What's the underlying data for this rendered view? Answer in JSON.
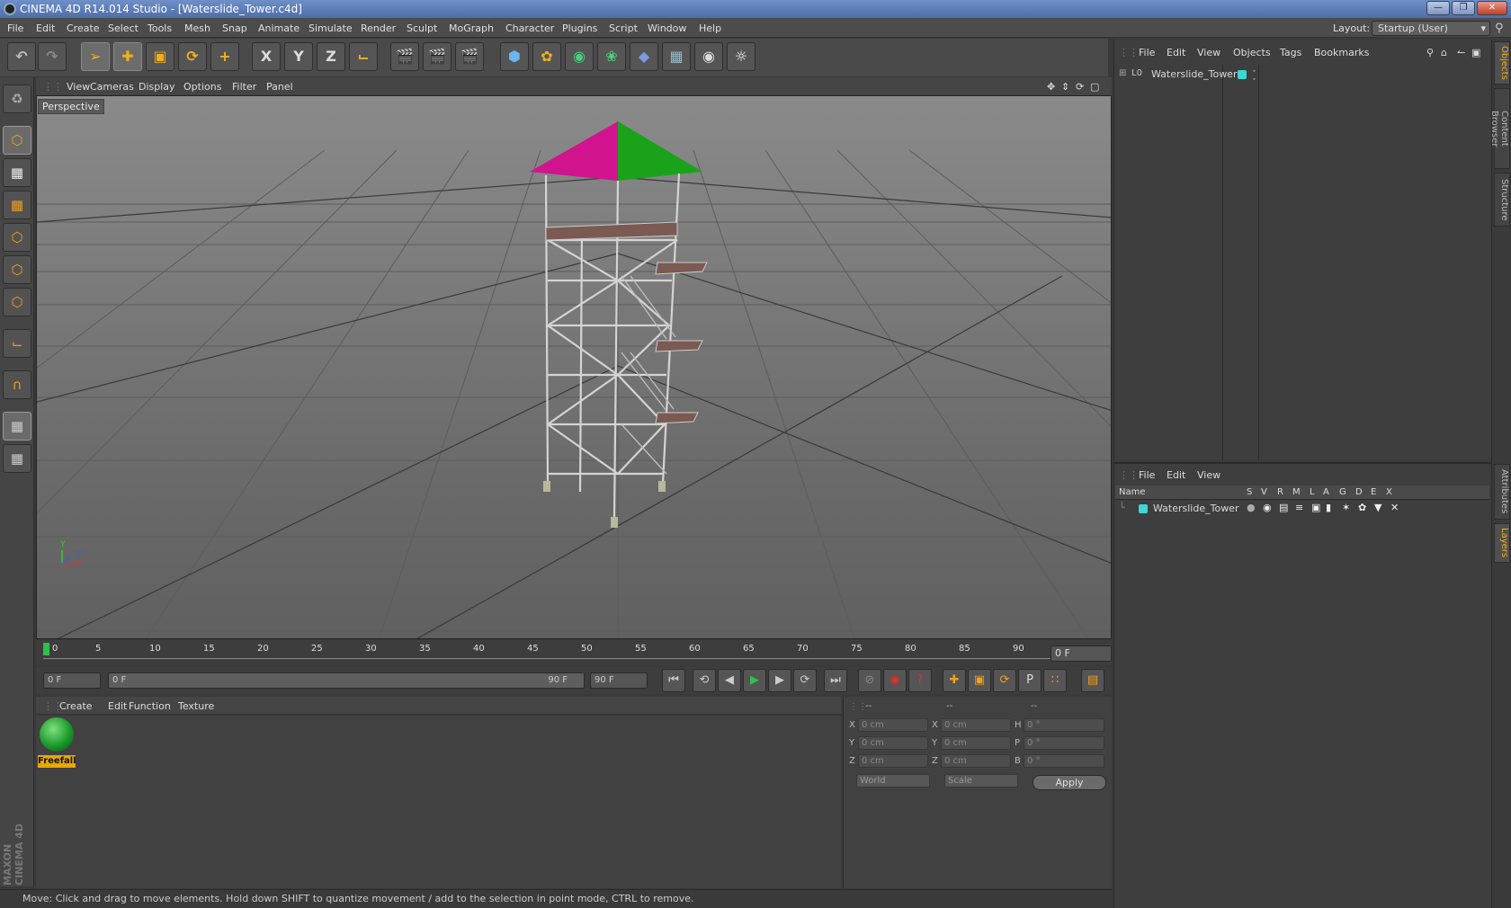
{
  "window": {
    "title": "CINEMA 4D R14.014 Studio - [Waterslide_Tower.c4d]"
  },
  "menubar": {
    "items": [
      "File",
      "Edit",
      "Create",
      "Select",
      "Tools",
      "Mesh",
      "Snap",
      "Animate",
      "Simulate",
      "Render",
      "Sculpt",
      "MoGraph",
      "Character",
      "Plugins",
      "Script",
      "Window",
      "Help"
    ],
    "layout_label": "Layout:",
    "layout_value": "Startup (User)"
  },
  "toolbar": {
    "icons": [
      "undo-icon",
      "redo-icon",
      "live-selection-icon",
      "move-icon",
      "scale-icon",
      "rotate-icon",
      "add-icon",
      "x-axis-icon",
      "y-axis-icon",
      "z-axis-icon",
      "coordinate-system-icon",
      "render-view-icon",
      "render-picture-viewer-icon",
      "render-settings-icon",
      "cube-primitive-icon",
      "spline-pen-icon",
      "subdivision-icon",
      "array-icon",
      "deformer-icon",
      "floor-icon",
      "camera-icon",
      "light-icon"
    ],
    "axis_x": "X",
    "axis_y": "Y",
    "axis_z": "Z"
  },
  "viewport": {
    "menu": [
      "View",
      "Cameras",
      "Display",
      "Options",
      "Filter",
      "Panel"
    ],
    "label": "Perspective",
    "axis_x": "X",
    "axis_y": "Y",
    "axis_z": "Z"
  },
  "timeline": {
    "ticks": [
      "0",
      "5",
      "10",
      "15",
      "20",
      "25",
      "30",
      "35",
      "40",
      "45",
      "50",
      "55",
      "60",
      "65",
      "70",
      "75",
      "80",
      "85",
      "90"
    ],
    "current_frame": "0 F"
  },
  "transport": {
    "start": "0 F",
    "range_start": "0 F",
    "range_end": "90 F",
    "end": "90 F"
  },
  "materials": {
    "menu": [
      "Create",
      "Edit",
      "Function",
      "Texture"
    ],
    "items": [
      {
        "name": "Freefall"
      }
    ]
  },
  "coordinates": {
    "headers": [
      "--",
      "--",
      "--"
    ],
    "rows": [
      {
        "l1": "X",
        "v1": "0 cm",
        "l2": "X",
        "v2": "0 cm",
        "l3": "H",
        "v3": "0 °"
      },
      {
        "l1": "Y",
        "v1": "0 cm",
        "l2": "Y",
        "v2": "0 cm",
        "l3": "P",
        "v3": "0 °"
      },
      {
        "l1": "Z",
        "v1": "0 cm",
        "l2": "Z",
        "v2": "0 cm",
        "l3": "B",
        "v3": "0 °"
      }
    ],
    "mode": "World",
    "transform": "Scale",
    "apply": "Apply"
  },
  "objects": {
    "menu": [
      "File",
      "Edit",
      "View",
      "Objects",
      "Tags",
      "Bookmarks"
    ],
    "items": [
      {
        "name": "Waterslide_Tower"
      }
    ]
  },
  "layers": {
    "menu": [
      "File",
      "Edit",
      "View"
    ],
    "columns": [
      "Name",
      "S",
      "V",
      "R",
      "M",
      "L",
      "A",
      "G",
      "D",
      "E",
      "X"
    ],
    "items": [
      {
        "name": "Waterslide_Tower"
      }
    ]
  },
  "right_tabs": [
    "Objects",
    "Content Browser",
    "Structure",
    "Attributes",
    "Layers"
  ],
  "status": "Move: Click and drag to move elements. Hold down SHIFT to quantize movement / add to the selection in point mode, CTRL to remove.",
  "brand": "MAXON CINEMA 4D",
  "colors": {
    "accent": "#f0b020",
    "layer_color": "#3fd6d6",
    "roof_left": "#d1148e",
    "roof_right": "#1aa31a"
  }
}
